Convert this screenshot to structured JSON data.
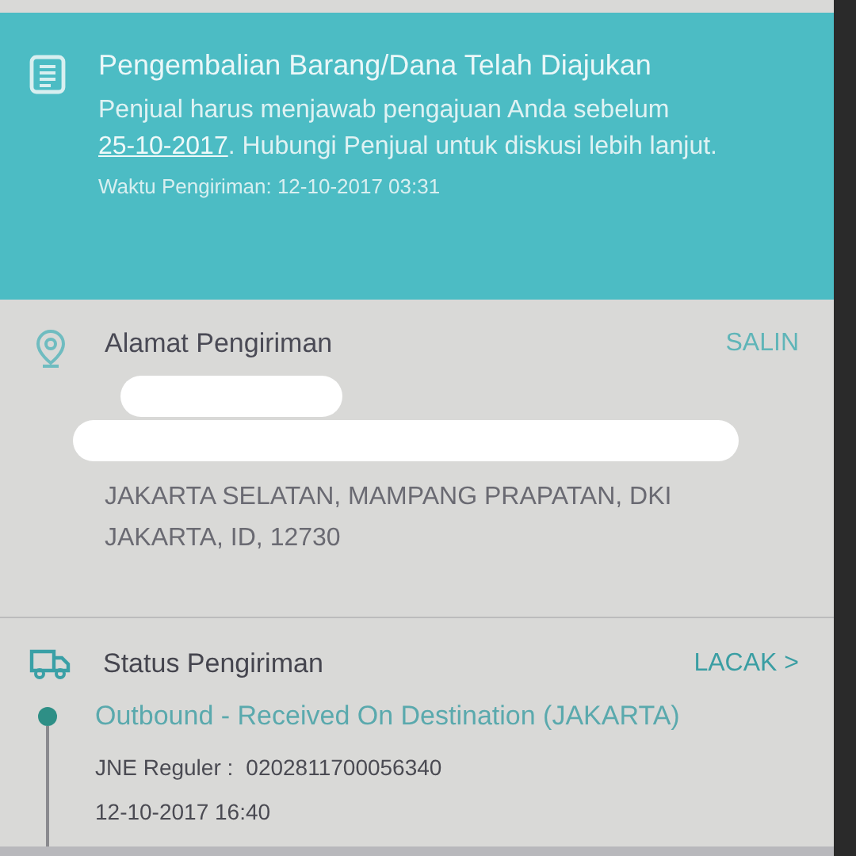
{
  "return_notice": {
    "title": "Pengembalian Barang/Dana Telah Diajukan",
    "message_before": "Penjual harus menjawab pengajuan Anda sebelum",
    "deadline_link": "25-10-2017",
    "message_after": ". Hubungi Penjual untuk diskusi lebih lanjut.",
    "sent_time": "Waktu Pengiriman: 12-10-2017 03:31"
  },
  "shipping_address": {
    "title": "Alamat Pengiriman",
    "action": "SALIN",
    "address_lines": [
      "JAKARTA SELATAN, MAMPANG PRAPATAN, DKI",
      "JAKARTA, ID, 12730"
    ]
  },
  "shipping_status": {
    "title": "Status Pengiriman",
    "action": "LACAK >",
    "latest_event": "Outbound - Received On Destination (JAKARTA)",
    "courier": "JNE Reguler :",
    "tracking_number": "0202811700056340",
    "event_time": "12-10-2017 16:40"
  }
}
